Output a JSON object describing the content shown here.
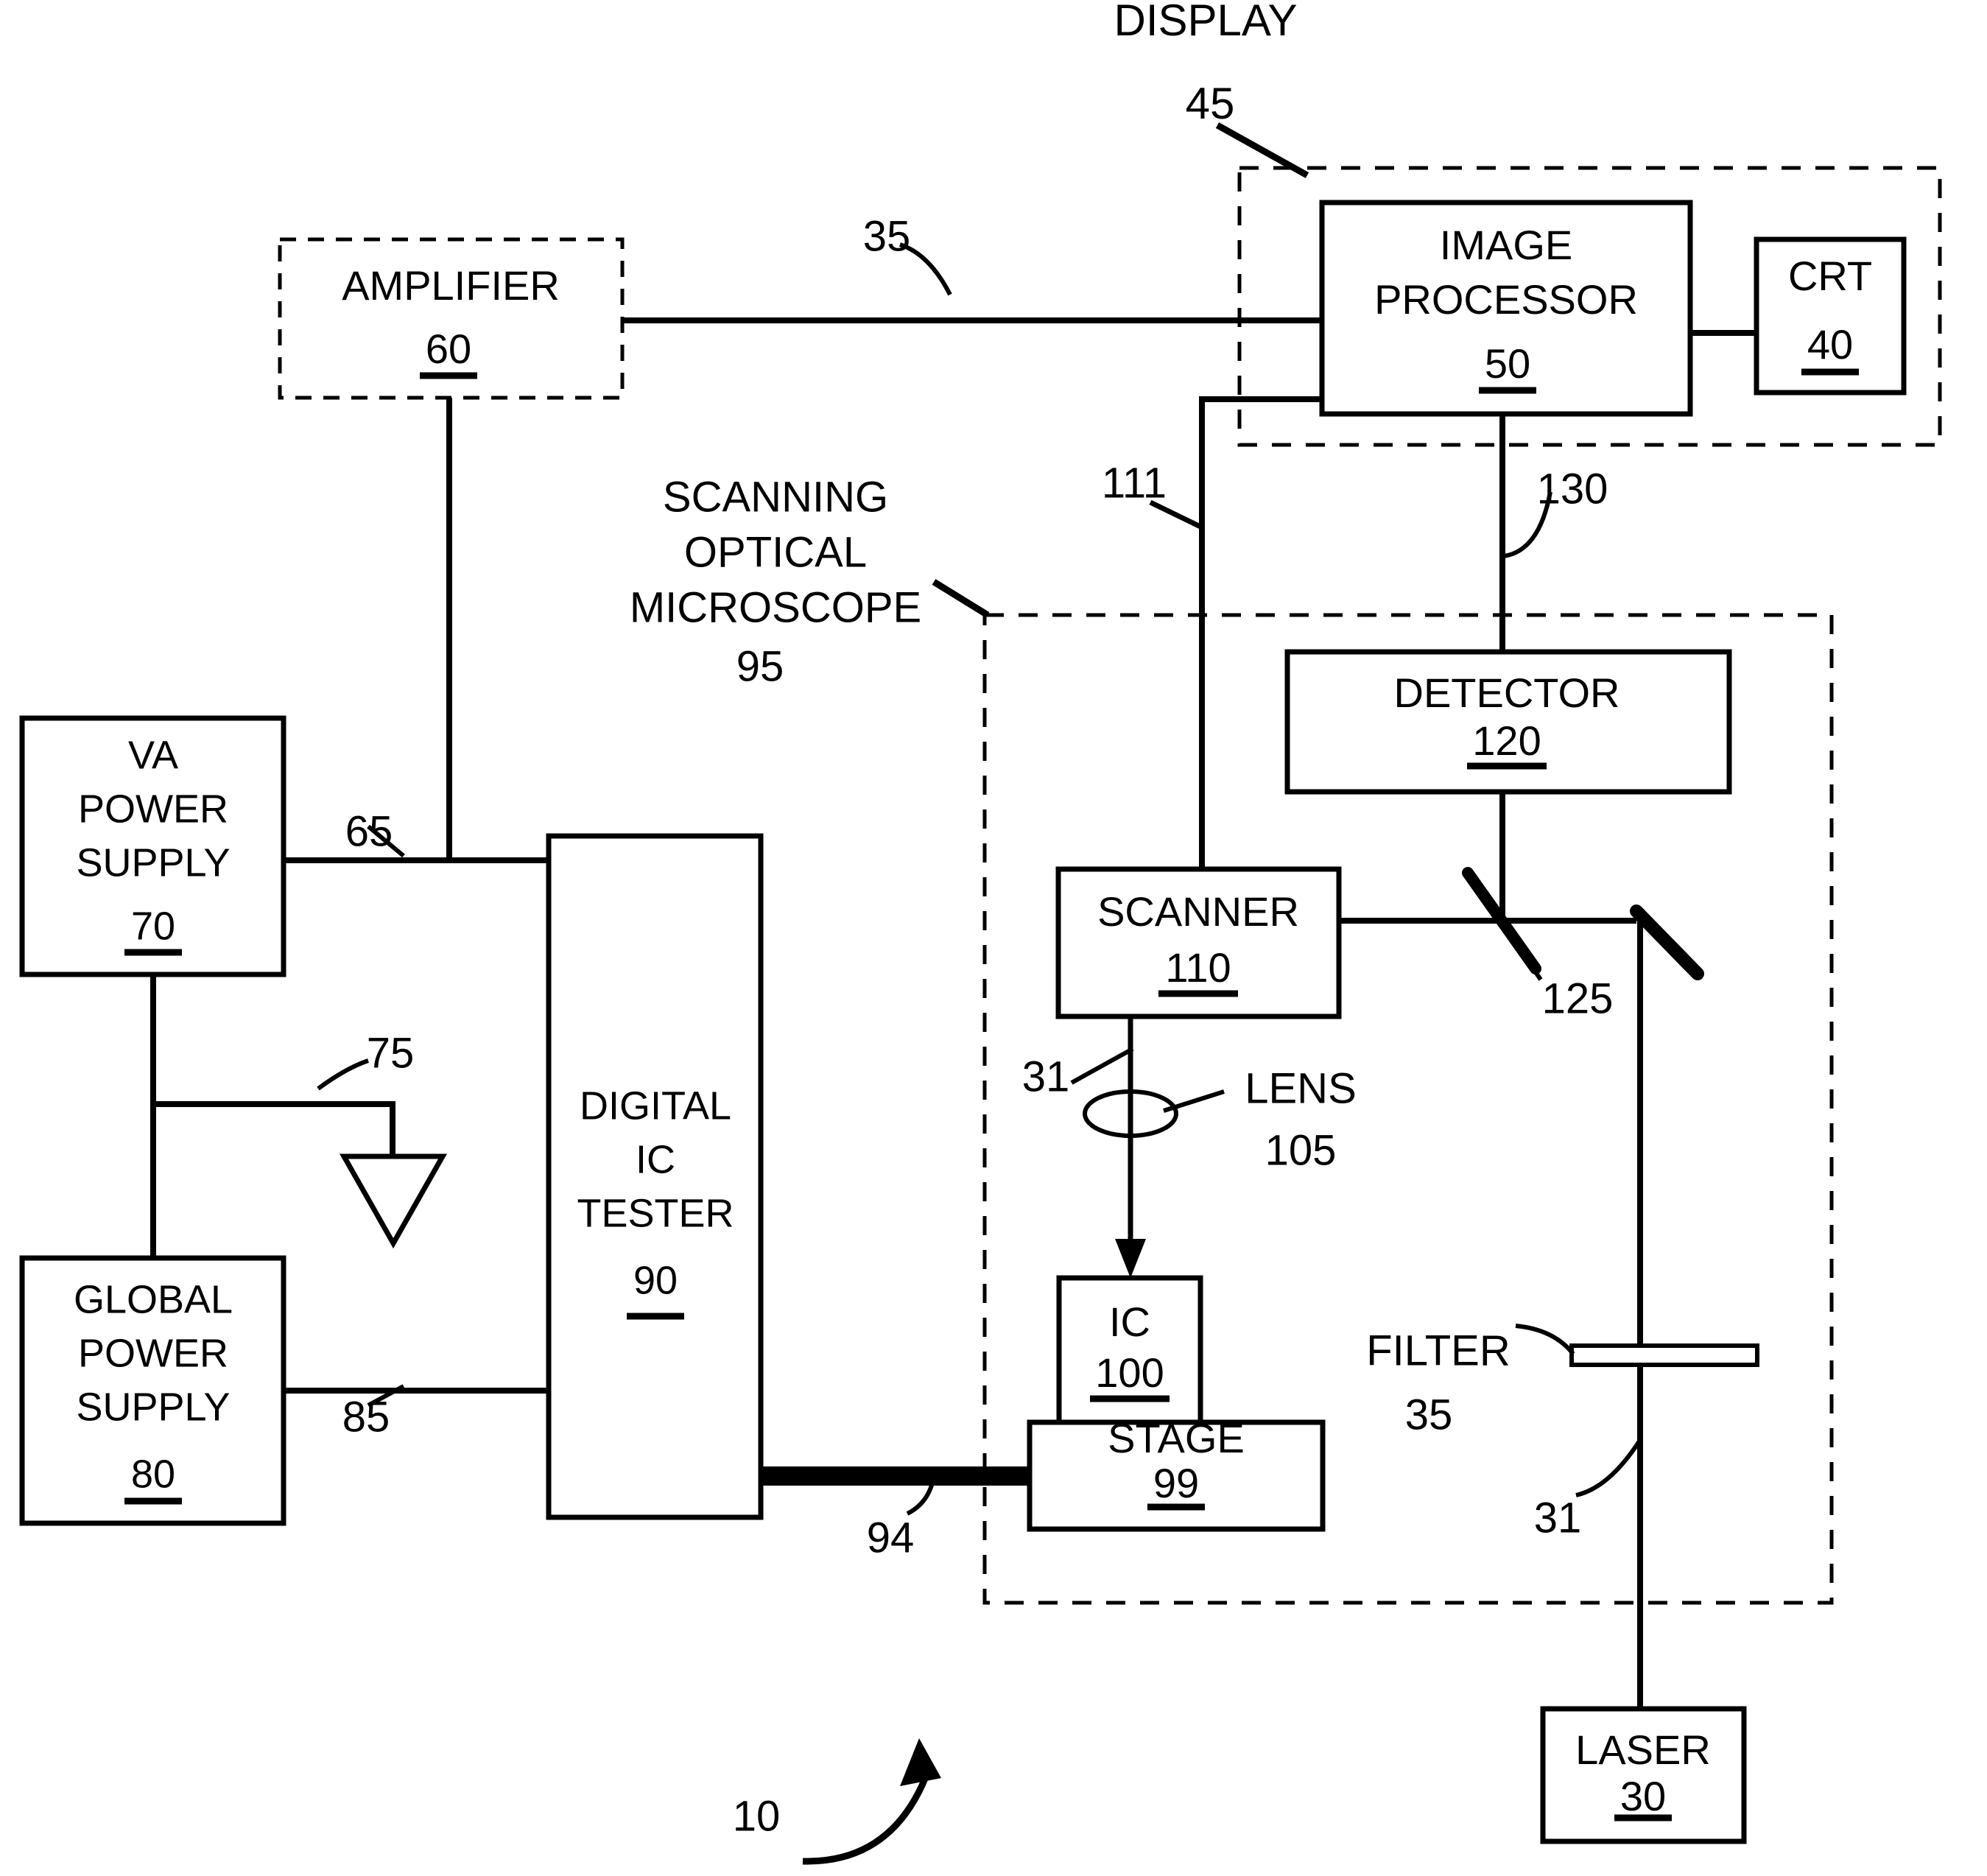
{
  "figure": {
    "system_reference": "10",
    "boxes": [
      {
        "id": "amplifier",
        "label_lines": [
          "AMPLIFIER"
        ],
        "ref": "60",
        "border": "dashed"
      },
      {
        "id": "image-processor",
        "label_lines": [
          "IMAGE",
          "PROCESSOR"
        ],
        "ref": "50",
        "border": "solid"
      },
      {
        "id": "crt",
        "label_lines": [
          "CRT"
        ],
        "ref": "40",
        "border": "solid"
      },
      {
        "id": "va-power-supply",
        "label_lines": [
          "VA",
          "POWER",
          "SUPPLY"
        ],
        "ref": "70",
        "border": "solid"
      },
      {
        "id": "global-power-supply",
        "label_lines": [
          "GLOBAL",
          "POWER",
          "SUPPLY"
        ],
        "ref": "80",
        "border": "solid"
      },
      {
        "id": "digital-ic-tester",
        "label_lines": [
          "DIGITAL",
          "IC",
          "TESTER"
        ],
        "ref": "90",
        "border": "solid"
      },
      {
        "id": "detector",
        "label_lines": [
          "DETECTOR"
        ],
        "ref": "120",
        "border": "solid"
      },
      {
        "id": "scanner",
        "label_lines": [
          "SCANNER"
        ],
        "ref": "110",
        "border": "solid"
      },
      {
        "id": "ic",
        "label_lines": [
          "IC"
        ],
        "ref": "100",
        "border": "solid"
      },
      {
        "id": "stage",
        "label_lines": [
          "STAGE"
        ],
        "ref": "99",
        "border": "solid"
      },
      {
        "id": "laser",
        "label_lines": [
          "LASER"
        ],
        "ref": "30",
        "border": "solid"
      }
    ],
    "enclosures": [
      {
        "id": "display-enclosure",
        "title": "DISPLAY",
        "ref": "45"
      },
      {
        "id": "microscope-enclosure",
        "title": "SCANNING OPTICAL MICROSCOPE",
        "ref": "95"
      }
    ],
    "enclosure_titles": {
      "display": "DISPLAY",
      "display_ref": "45",
      "microscope_line1": "SCANNING",
      "microscope_line2": "OPTICAL",
      "microscope_line3": "MICROSCOPE",
      "microscope_ref": "95"
    },
    "components": [
      {
        "id": "lens",
        "label": "LENS",
        "ref": "105"
      },
      {
        "id": "filter",
        "label": "FILTER",
        "ref": "35"
      },
      {
        "id": "beamsplitter",
        "label": "",
        "ref": "125"
      },
      {
        "id": "mirror",
        "label": "",
        "ref": ""
      },
      {
        "id": "ground-symbol",
        "label": "",
        "ref": "75"
      }
    ],
    "connection_refs": {
      "amplifier_to_image_processor": "35",
      "image_processor_to_scanner": "111",
      "image_processor_to_detector": "130",
      "va_supply_to_tester": "65",
      "ground": "75",
      "global_supply_to_tester": "85",
      "tester_to_stage": "94",
      "laser_beam_lower": "31",
      "laser_beam_upper": "31",
      "beamsplitter": "125",
      "lens_ref": "105",
      "filter_ref": "35"
    },
    "colors": {
      "stroke": "#000000",
      "background": "#ffffff"
    }
  }
}
